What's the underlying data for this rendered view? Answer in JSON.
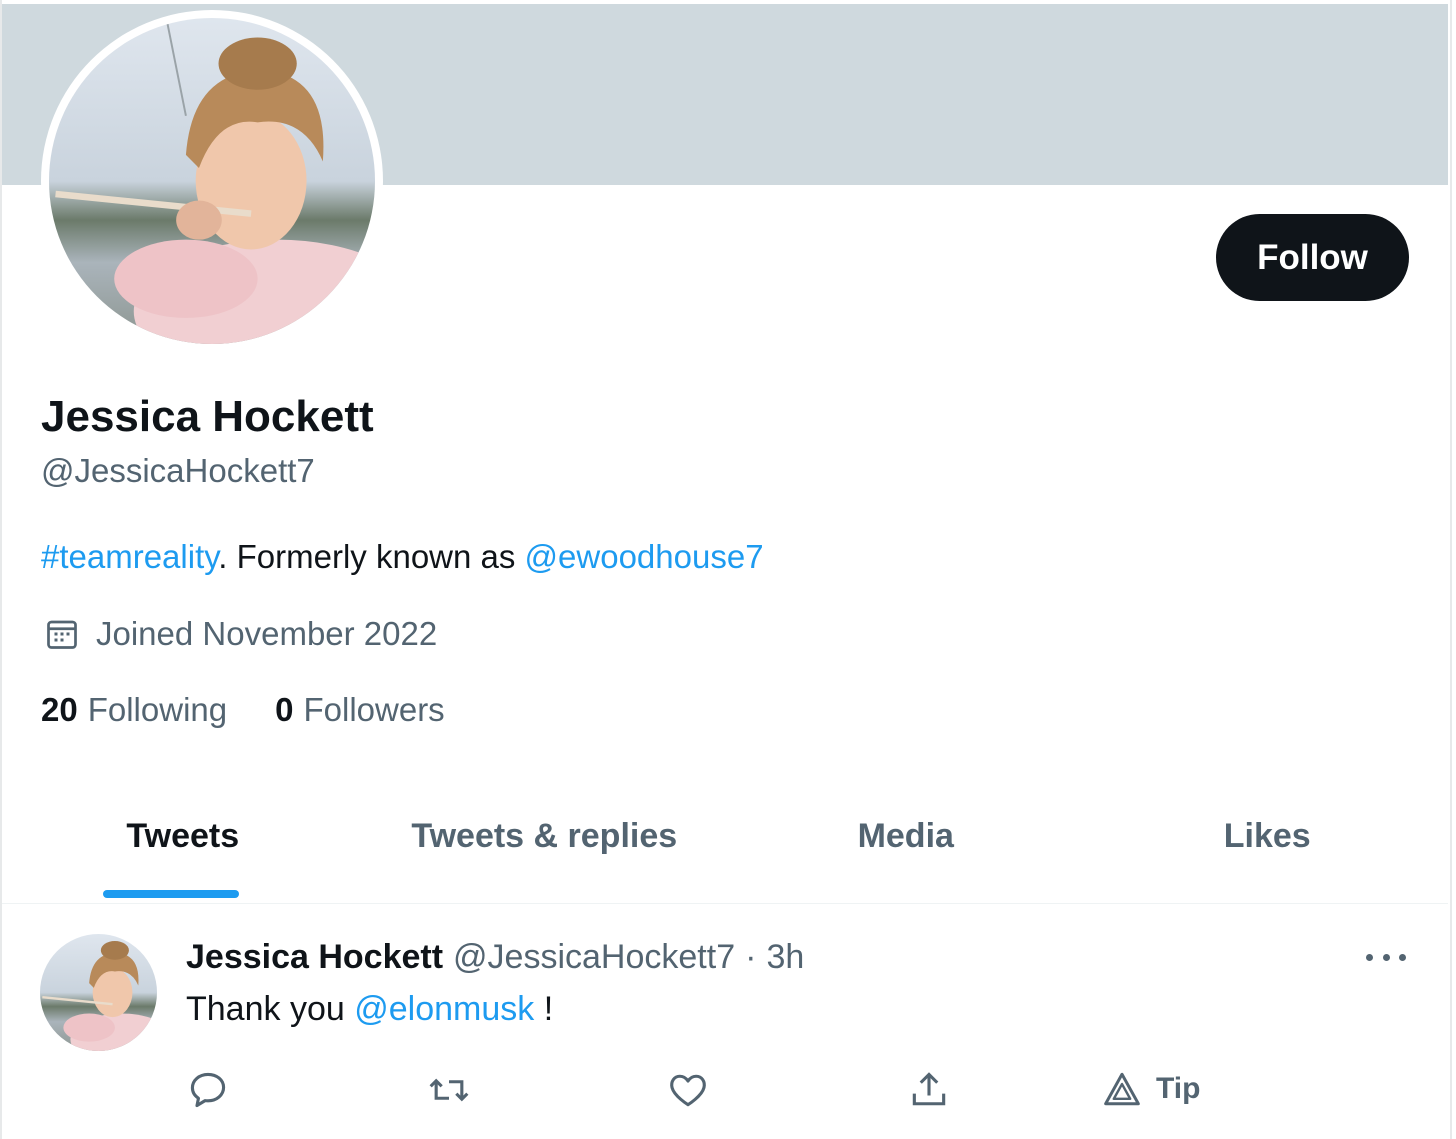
{
  "profile": {
    "display_name": "Jessica Hockett",
    "handle": "@JessicaHockett7",
    "bio": {
      "hashtag": "#teamreality",
      "text": ". Formerly known as ",
      "mention": "@ewoodhouse7"
    },
    "joined": "Joined November 2022",
    "following_count": "20",
    "following_label": "Following",
    "followers_count": "0",
    "followers_label": "Followers"
  },
  "follow_button": {
    "label": "Follow"
  },
  "tabs": [
    {
      "label": "Tweets",
      "active": true
    },
    {
      "label": "Tweets & replies",
      "active": false
    },
    {
      "label": "Media",
      "active": false
    },
    {
      "label": "Likes",
      "active": false
    }
  ],
  "tweet": {
    "author_name": "Jessica Hockett",
    "author_handle": "@JessicaHockett7",
    "separator": "·",
    "time": "3h",
    "text_before": "Thank you ",
    "mention": "@elonmusk",
    "text_after": " !",
    "actions": [
      {
        "icon": "reply-icon"
      },
      {
        "icon": "retweet-icon"
      },
      {
        "icon": "like-icon"
      },
      {
        "icon": "share-icon"
      },
      {
        "icon": "tip-icon",
        "label": "Tip"
      }
    ]
  },
  "colors": {
    "banner": "#cfd9de",
    "accent": "#1d9bf0",
    "text_primary": "#0f1419",
    "text_secondary": "#536471",
    "button_bg": "#0f1419"
  }
}
